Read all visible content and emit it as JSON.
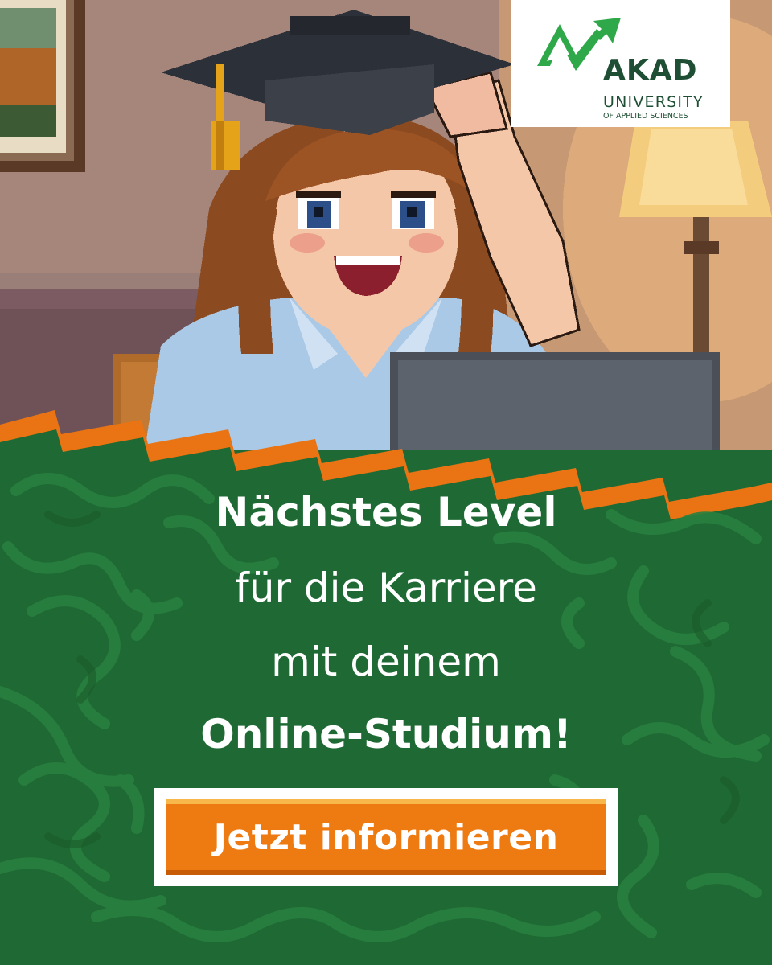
{
  "logo": {
    "brand": "AKAD",
    "line1": "UNIVERSITY",
    "line2": "OF APPLIED SCIENCES"
  },
  "headline": {
    "line1": "Nächstes Level",
    "line2": "für die Karriere",
    "line3": "mit deinem",
    "line4": "Online-Studium!"
  },
  "cta": {
    "label": "Jetzt informieren"
  },
  "colors": {
    "brand_green": "#1f6a34",
    "accent_orange": "#ee7a12",
    "logo_green": "#2fa84a"
  }
}
